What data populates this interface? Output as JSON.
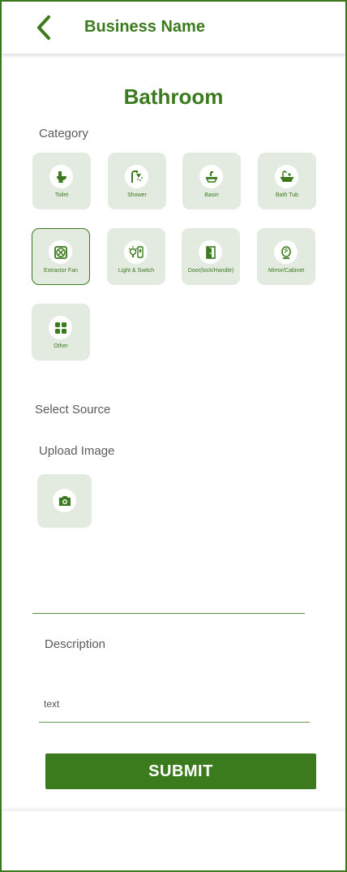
{
  "header": {
    "title": "Business Name",
    "back_icon": "chevron-left-icon"
  },
  "page": {
    "title": "Bathroom"
  },
  "category": {
    "label": "Category",
    "items": [
      {
        "label": "Toilet",
        "icon": "toilet-icon",
        "selected": false
      },
      {
        "label": "Shower",
        "icon": "shower-icon",
        "selected": false
      },
      {
        "label": "Basin",
        "icon": "basin-icon",
        "selected": false
      },
      {
        "label": "Bath Tub",
        "icon": "bathtub-icon",
        "selected": false
      },
      {
        "label": "Extractor Fan",
        "icon": "fan-icon",
        "selected": true
      },
      {
        "label": "Light & Switch",
        "icon": "light-switch-icon",
        "selected": false
      },
      {
        "label": "Door(lock/Handle)",
        "icon": "door-icon",
        "selected": false
      },
      {
        "label": "Mirror/Cabinet",
        "icon": "mirror-icon",
        "selected": false
      },
      {
        "label": "Other",
        "icon": "grid-icon",
        "selected": false
      }
    ]
  },
  "source": {
    "label": "Select Source"
  },
  "upload": {
    "label": "Upload Image",
    "icon": "camera-icon"
  },
  "description": {
    "label": "Description",
    "value": "text"
  },
  "submit": {
    "label": "SUBMIT"
  },
  "colors": {
    "primary": "#3c7a1e",
    "tile_bg": "#e3ebe0",
    "text_muted": "#5b5b5b"
  }
}
